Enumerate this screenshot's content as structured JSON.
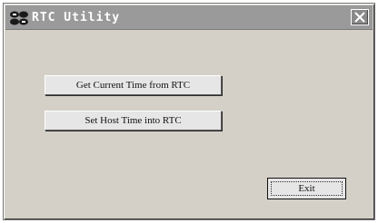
{
  "window": {
    "title": "RTC Utility",
    "close_glyph": "✕"
  },
  "buttons": {
    "get_time": "Get Current Time from RTC",
    "set_time": "Set Host Time into RTC",
    "exit": "Exit"
  },
  "icons": {
    "app": "rtc-app-icon",
    "close": "close-icon"
  },
  "colors": {
    "titlebar": "#9a9a9a",
    "window_bg": "#d4d0c8",
    "button_bg": "#e6e6e6"
  }
}
